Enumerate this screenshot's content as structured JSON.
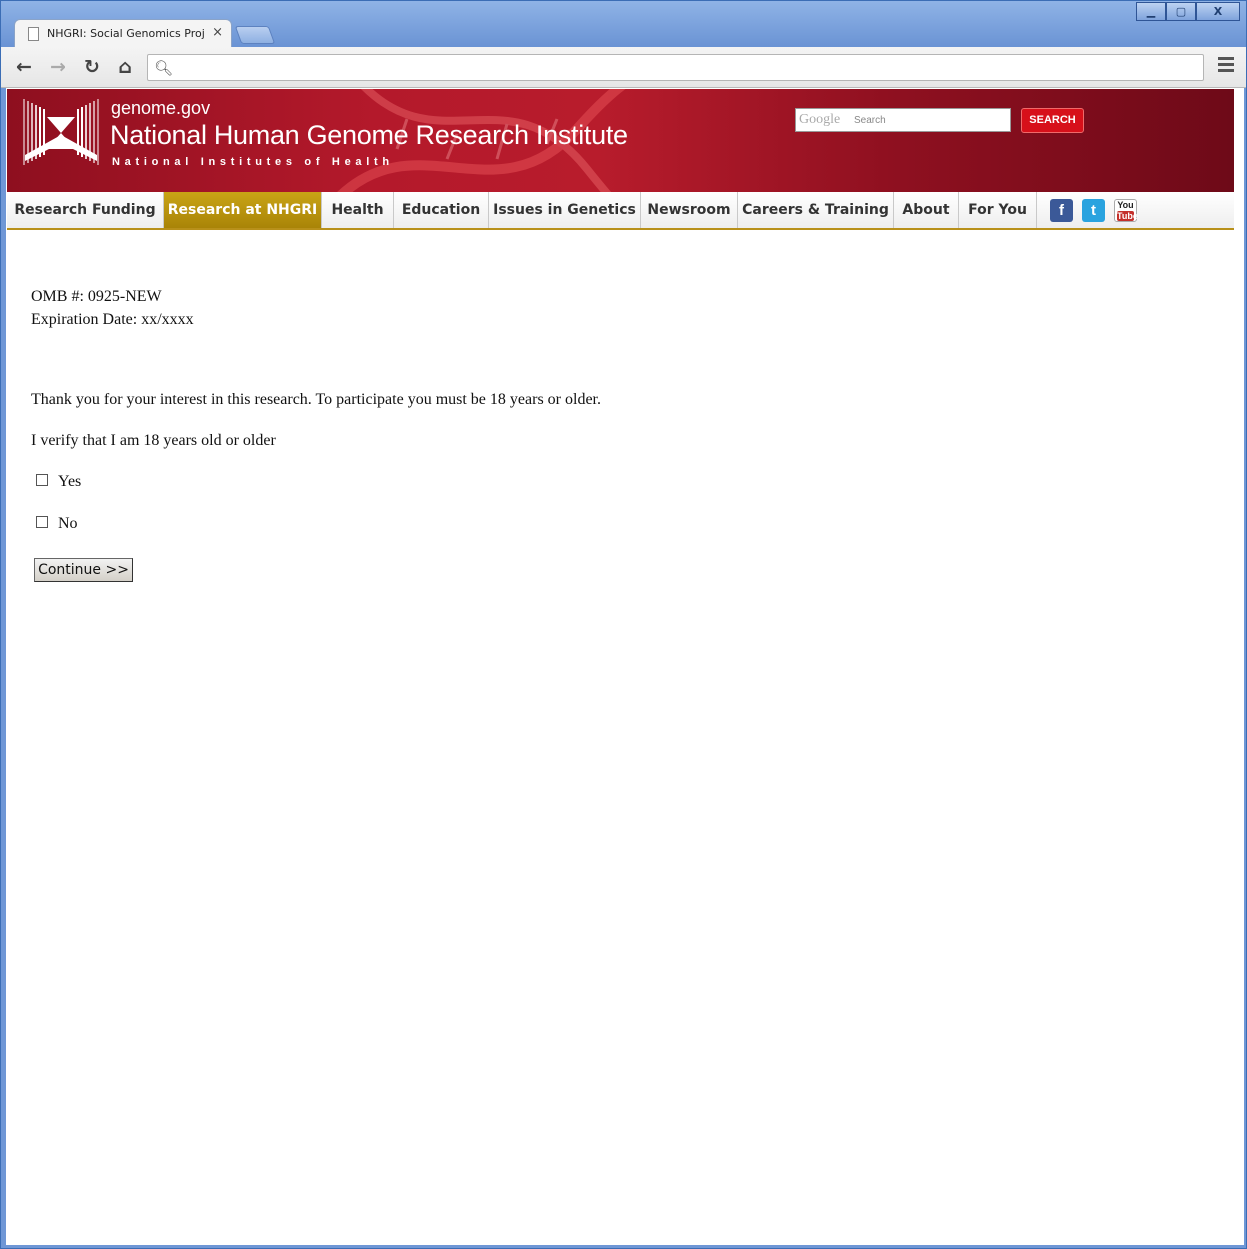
{
  "browser": {
    "tab_title": "NHGRI: Social Genomics Proj",
    "tab_close": "×",
    "address": "",
    "nav": {
      "back": "←",
      "forward": "→",
      "reload": "↻",
      "home": "⌂"
    },
    "window_buttons": {
      "minimize": "▁",
      "maximize": "▢",
      "close": "X"
    }
  },
  "site": {
    "domain": "genome.gov",
    "title": "National Human Genome Research Institute",
    "subtitle": "National Institutes of Health",
    "search": {
      "brand": "Google",
      "placeholder": "Search",
      "button": "SEARCH"
    }
  },
  "nav": {
    "items": [
      {
        "label": "Research Funding",
        "active": false
      },
      {
        "label": "Research at NHGRI",
        "active": true
      },
      {
        "label": "Health",
        "active": false
      },
      {
        "label": "Education",
        "active": false
      },
      {
        "label": "Issues in Genetics",
        "active": false
      },
      {
        "label": "Newsroom",
        "active": false
      },
      {
        "label": "Careers & Training",
        "active": false
      },
      {
        "label": "About",
        "active": false
      },
      {
        "label": "For You",
        "active": false
      }
    ],
    "social": {
      "facebook": "f",
      "twitter": "t",
      "youtube_top": "You",
      "youtube_bottom": "Tube"
    }
  },
  "form": {
    "omb_number": "OMB #: 0925-NEW",
    "expiration": "Expiration Date: xx/xxxx",
    "intro": "Thank you for your interest in this research. To participate you must be 18 years or older.",
    "question": "I verify that I am 18 years old or older",
    "options": [
      {
        "label": "Yes",
        "checked": false
      },
      {
        "label": "No",
        "checked": false
      }
    ],
    "continue_label": "Continue >>"
  },
  "colors": {
    "header_red": "#b4192b",
    "nav_active_gold": "#b8901a",
    "search_button": "#d7101a"
  }
}
